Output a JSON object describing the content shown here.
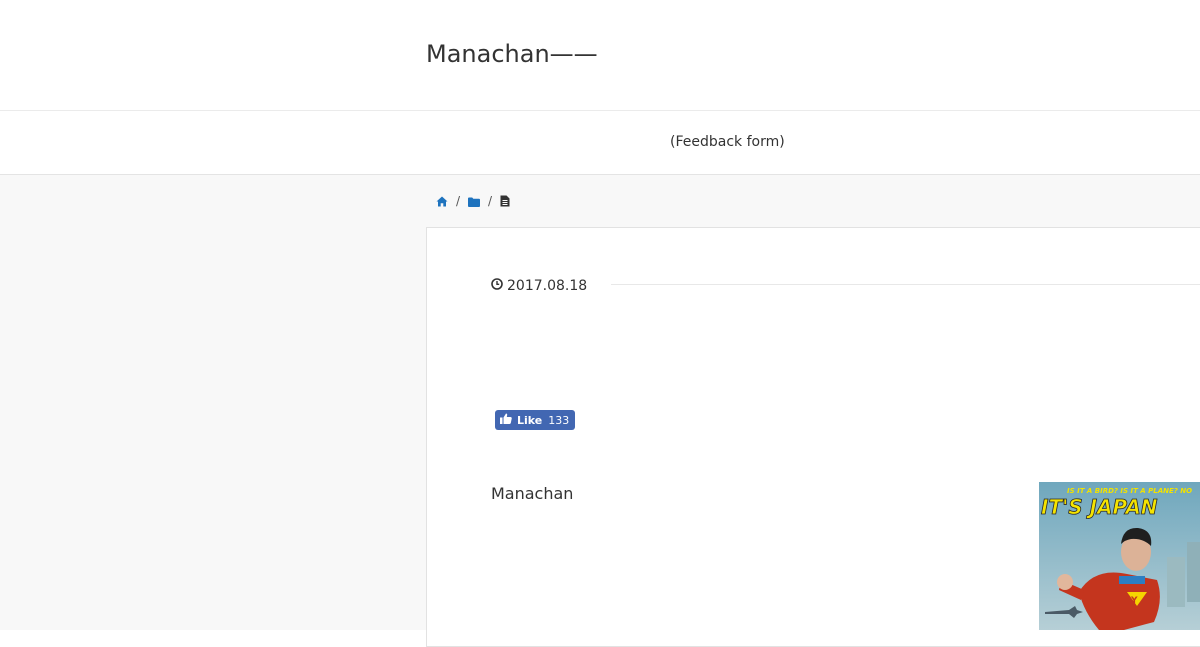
{
  "header": {
    "site_title": "Manachan——"
  },
  "nav": {
    "feedback_link": "(Feedback form)"
  },
  "breadcrumb": {
    "items": [
      {
        "icon": "home-icon"
      },
      {
        "icon": "folder-icon"
      },
      {
        "icon": "document-icon"
      }
    ],
    "separator": "/"
  },
  "post": {
    "date": "2017.08.18",
    "date_icon": "clock-icon",
    "fb_like": {
      "label": "Like",
      "count": "133"
    },
    "author": "Manachan"
  },
  "ad_banner": {
    "top_text": "IS IT A BIRD? IS IT A PLANE? NO",
    "headline": "IT'S JAPAN"
  },
  "colors": {
    "accent": "#1e73be",
    "facebook": "#4267b2",
    "page_bg": "#f8f8f8"
  }
}
